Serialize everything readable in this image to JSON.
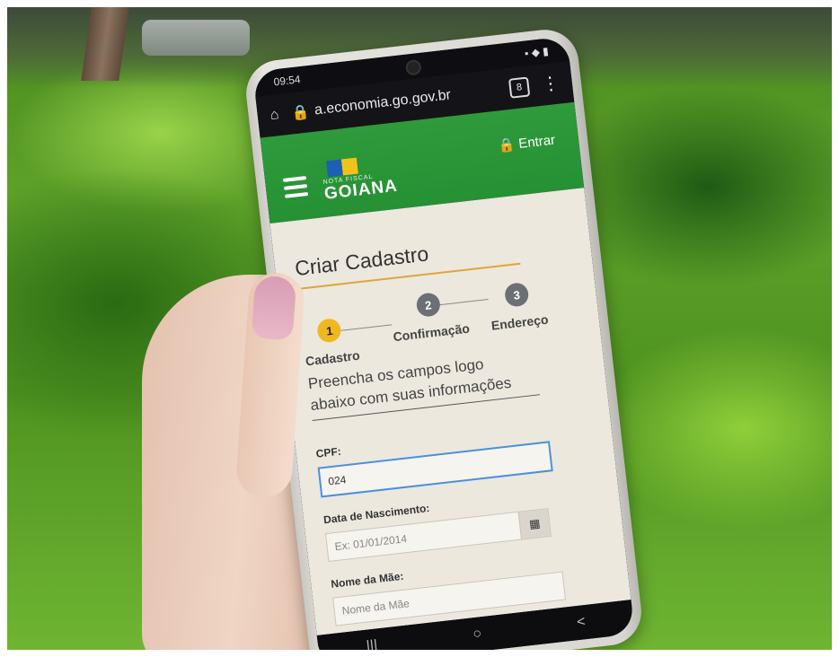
{
  "status_bar": {
    "time": "09:54"
  },
  "browser": {
    "url": "a.economia.go.gov.br",
    "tab_count": "8"
  },
  "app_header": {
    "logo_small": "NOTA FISCAL",
    "logo_name": "GOIANA",
    "login_label": "Entrar"
  },
  "form": {
    "title": "Criar Cadastro",
    "steps": [
      {
        "number": "1",
        "label": "Cadastro"
      },
      {
        "number": "2",
        "label": "Confirmação"
      },
      {
        "number": "3",
        "label": "Endereço"
      }
    ],
    "intro": "Preencha os campos logo abaixo com suas informações",
    "fields": {
      "cpf": {
        "label": "CPF:",
        "value": "024"
      },
      "birth": {
        "label": "Data de Nascimento:",
        "placeholder": "Ex: 01/01/2014"
      },
      "mother": {
        "label": "Nome da Mãe:",
        "placeholder": "Nome da Mãe"
      }
    }
  },
  "nav": {
    "recent": "|||",
    "home": "○",
    "back": "<"
  },
  "colors": {
    "header_green": "#2f9a3b",
    "step_active": "#efb81e",
    "step_inactive": "#6c6f73",
    "title_rule": "#e0a53a"
  }
}
